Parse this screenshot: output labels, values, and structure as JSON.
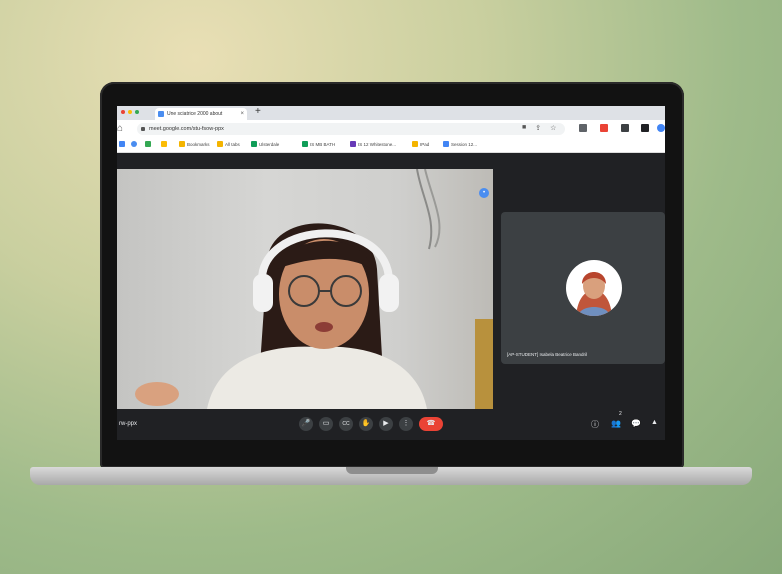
{
  "browser": {
    "tab_title": "Une sciatrice 2000 about",
    "tab_close": "×",
    "new_tab": "+",
    "url": "meet.google.com/stu-fsow-ppx",
    "bookmarks": [
      {
        "label": "Bookmarks",
        "color": "#f4b400"
      },
      {
        "label": "All tabs",
        "color": "#f4b400"
      },
      {
        "label": "Ulsterdale",
        "color": "#0f9d58"
      },
      {
        "label": "IS MB BATH",
        "color": "#0f9d58"
      },
      {
        "label": "IS 12 Whitestone...",
        "color": "#673ab7"
      },
      {
        "label": "IPad",
        "color": "#f4b400"
      },
      {
        "label": "Session 12...",
        "color": "#4285f4"
      }
    ]
  },
  "meet": {
    "meeting_code": "rw-ppx",
    "self_name": "[AP-STUDENT] Isabela Beatrice Bandril",
    "participant_count": "2",
    "controls": {
      "mic": "🎤",
      "camera": "▭",
      "captions": "CC",
      "hand": "✋",
      "present": "▶",
      "more": "⋮",
      "leave": "☎"
    },
    "right_controls": {
      "info": "ⓘ",
      "people": "👥",
      "chat": "💬",
      "activities": "▲"
    },
    "accent": "#ea4335"
  }
}
